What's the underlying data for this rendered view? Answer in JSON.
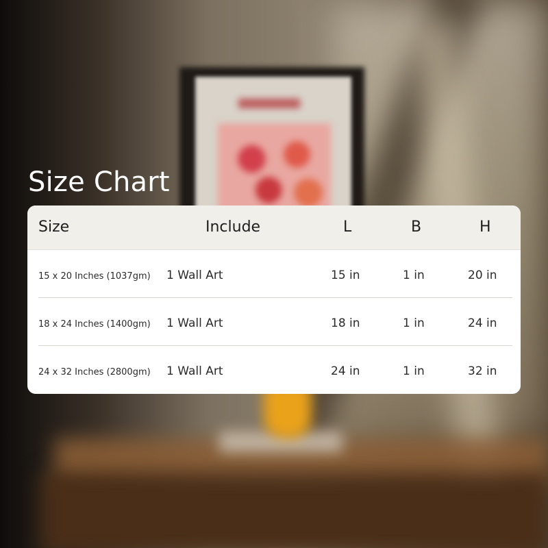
{
  "title": "Size Chart",
  "table": {
    "headers": [
      "Size",
      "Include",
      "L",
      "B",
      "H"
    ],
    "rows": [
      {
        "size": "15 x 20 Inches (1037gm)",
        "include": "1 Wall Art",
        "l": "15 in",
        "b": "1 in",
        "h": "20 in"
      },
      {
        "size": "18 x 24 Inches (1400gm)",
        "include": "1 Wall Art",
        "l": "18 in",
        "b": "1 in",
        "h": "24 in"
      },
      {
        "size": "24 x 32 Inches (2800gm)",
        "include": "1 Wall Art",
        "l": "24 in",
        "b": "1 in",
        "h": "32 in"
      }
    ]
  },
  "colors": {
    "header_bg": "#f0efea",
    "card_bg": "#ffffff",
    "title_text": "#ffffff"
  }
}
